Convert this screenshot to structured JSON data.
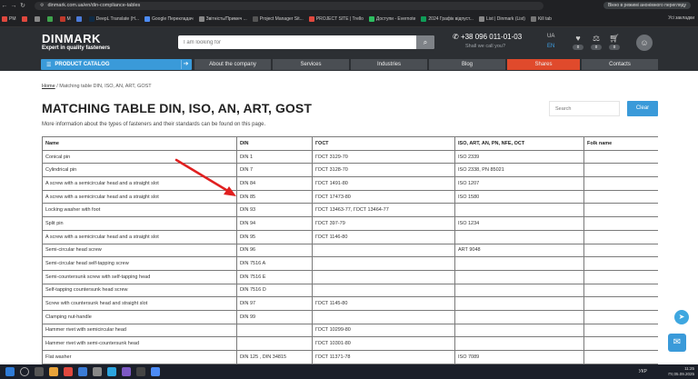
{
  "browser": {
    "url": "dinmark.com.ua/en/din-compliance-tables",
    "incognito_text": "Вікно в режимі анонімного перегляду",
    "bookmarks": [
      {
        "label": "PM",
        "color": "#e0483e"
      },
      {
        "label": "",
        "color": "#e0483e"
      },
      {
        "label": "",
        "color": "#888"
      },
      {
        "label": "",
        "color": "#3fa34d"
      },
      {
        "label": "M",
        "color": "#c0392b"
      },
      {
        "label": "",
        "color": "#4c7bd9"
      },
      {
        "label": "DeepL Translate (Н...",
        "color": "#0f2b46"
      },
      {
        "label": "Google Перекладач",
        "color": "#4c8bf5"
      },
      {
        "label": "Звітність/Примеч ...",
        "color": "#888"
      },
      {
        "label": "Project Manager Sit...",
        "color": "#555"
      },
      {
        "label": "PROJECT SITE | Trello",
        "color": "#e0483e"
      },
      {
        "label": "Доступи - Evernote",
        "color": "#2dbe60"
      },
      {
        "label": "2024 Графік відпуст...",
        "color": "#0f9d58"
      },
      {
        "label": "List | Dinmark (List)",
        "color": "#888"
      },
      {
        "label": "Kill tab",
        "color": "#777"
      }
    ],
    "bookmarks_right": "Усі закладки"
  },
  "header": {
    "logo": "DINMARK",
    "logo_sub": "Expert in quality fasteners",
    "search_placeholder": "I am looking for",
    "phone": "+38 096 011-01-03",
    "callback": "Shall we call you?",
    "lang_ua": "UA",
    "lang_en": "EN",
    "badges": [
      "0",
      "0",
      "0"
    ]
  },
  "menu": {
    "catalog": "PRODUCT CATALOG",
    "items": [
      "About the company",
      "Services",
      "Industries",
      "Blog",
      "Shares",
      "Contacts"
    ]
  },
  "content": {
    "breadcrumb_home": "Home",
    "breadcrumb_current": " / Matching table DIN, ISO, AN, ART, GOST",
    "title": "MATCHING TABLE DIN, ISO, AN, ART, GOST",
    "intro": "More information about the types of fasteners and their standards can be found on this page.",
    "search_placeholder": "Search",
    "clear_label": "Clear"
  },
  "table": {
    "headers": [
      "Name",
      "DIN",
      "ГОСТ",
      "ISO, ART, AN, PN, NFE, OCT",
      "Folk name"
    ],
    "rows": [
      [
        "Conical pin",
        "DIN 1",
        "ГОСТ 3129-70",
        "ISO 2339",
        ""
      ],
      [
        "Cylindrical pin",
        "DIN 7",
        "ГОСТ 3128-70",
        "ISO 2338, PN 85021",
        ""
      ],
      [
        "A screw with a semicircular head and a straight slot",
        "DIN 84",
        "ГОСТ 1491-80",
        "ISO 1207",
        ""
      ],
      [
        "A screw with a semicircular head and a straight slot",
        "DIN 85",
        "ГОСТ 17473-80",
        "ISO 1580",
        ""
      ],
      [
        "Locking washer with foot",
        "DIN 93",
        "ГОСТ 13463-77, ГОСТ 13464-77",
        "",
        ""
      ],
      [
        "Split pin",
        "DIN 94",
        "ГОСТ 397-79",
        "ISO 1234",
        ""
      ],
      [
        "A screw with a semicircular head and a straight slot",
        "DIN 95",
        "ГОСТ 1146-80",
        "",
        ""
      ],
      [
        "Semi-circular head screw",
        "DIN 96",
        "",
        "ART 9048",
        ""
      ],
      [
        "Semi-circular head self-tapping screw",
        "DIN 7516 A",
        "",
        "",
        ""
      ],
      [
        "Semi-countersunk screw with self-tapping head",
        "DIN 7516 E",
        "",
        "",
        ""
      ],
      [
        "Self-tapping countersunk head screw",
        "DIN 7516 D",
        "",
        "",
        ""
      ],
      [
        "Screw with countersunk head and straight slot",
        "DIN 97",
        "ГОСТ 1145-80",
        "",
        ""
      ],
      [
        "Clamping nut-handle",
        "DIN 99",
        "",
        "",
        ""
      ],
      [
        "Hammer rivet with semicircular head",
        "",
        "ГОСТ 10299-80",
        "",
        ""
      ],
      [
        "Hammer rivet with semi-countersunk head",
        "",
        "ГОСТ 10301-80",
        "",
        ""
      ],
      [
        "Flat washer",
        "DIN 125 , DIN 34815",
        "ГОСТ 11371-78",
        "ISO 7089",
        ""
      ]
    ]
  },
  "taskbar": {
    "lang": "УКР",
    "time": "11:25",
    "date": "Пт,05.09.2025"
  }
}
